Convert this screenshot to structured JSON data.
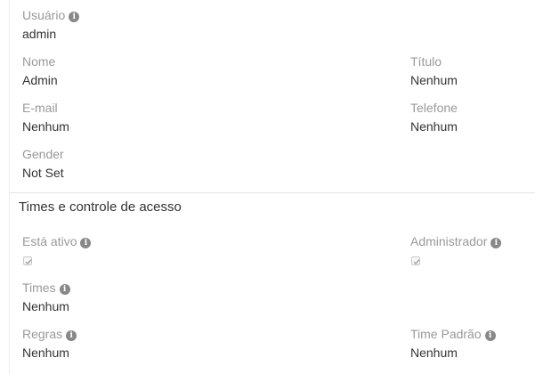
{
  "overview": {
    "username_label": "Usuário",
    "username_value": "admin",
    "name_label": "Nome",
    "name_value": "Admin",
    "title_label": "Título",
    "title_value": "Nenhum",
    "email_label": "E-mail",
    "email_value": "Nenhum",
    "phone_label": "Telefone",
    "phone_value": "Nenhum",
    "gender_label": "Gender",
    "gender_value": "Not Set"
  },
  "access": {
    "heading": "Times e controle de acesso",
    "is_active_label": "Está ativo",
    "is_active_checked": true,
    "admin_label": "Administrador",
    "admin_checked": true,
    "teams_label": "Times",
    "teams_value": "Nenhum",
    "roles_label": "Regras",
    "roles_value": "Nenhum",
    "default_team_label": "Time Padrão",
    "default_team_value": "Nenhum"
  },
  "icons": {
    "info": "info-circle-icon",
    "check": "checkmark-icon"
  }
}
